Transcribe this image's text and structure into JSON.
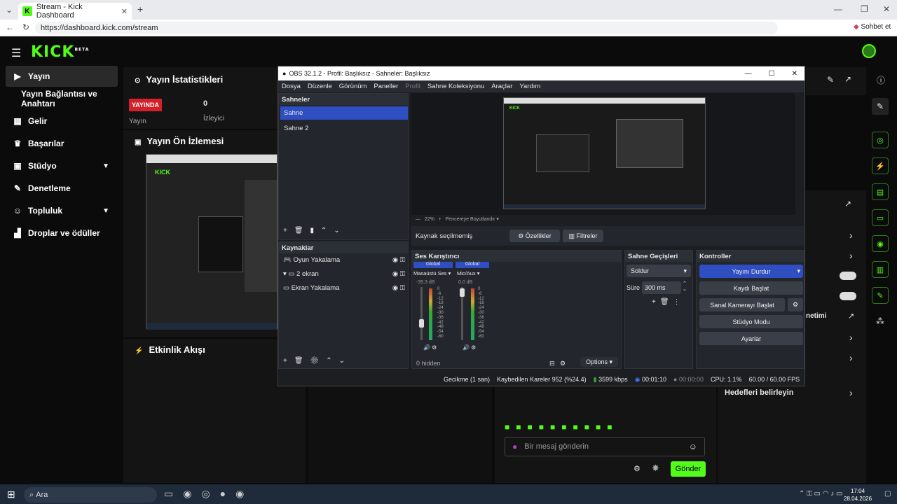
{
  "browser": {
    "tab_title": "Stream - Kick Dashboard",
    "url": "https://dashboard.kick.com/stream",
    "sohbet": "Sohbet et"
  },
  "kick": {
    "logo": "KICK",
    "beta": "BETA",
    "sidebar": [
      {
        "label": "Yayın",
        "icon": "broadcast-icon"
      },
      {
        "label": "Yayın Bağlantısı ve Anahtarı",
        "icon": ""
      },
      {
        "label": "Gelir",
        "icon": "chart-icon"
      },
      {
        "label": "Başarılar",
        "icon": "trophy-icon"
      },
      {
        "label": "Stüdyo",
        "icon": "studio-icon"
      },
      {
        "label": "Denetleme",
        "icon": "wrench-icon"
      },
      {
        "label": "Topluluk",
        "icon": "people-icon"
      },
      {
        "label": "Droplar ve ödüller",
        "icon": "gift-icon"
      }
    ],
    "stats_title": "Yayın İstatistikleri",
    "live_badge": "YAYINDA",
    "yayin_label": "Yayın",
    "viewers_value": "0",
    "viewers_label": "İzleyici",
    "preview_title": "Yayın Ön İzlemesi",
    "activity_title": "Etkinlik Akışı",
    "right_items": [
      "netimi",
      "Hedefleri belirleyin"
    ],
    "chat_placeholder": "Bir mesaj gönderin",
    "send": "Gönder"
  },
  "obs": {
    "title": "OBS 32.1.2 - Profil: Başlıksız - Sahneler: Başlıksız",
    "menu": [
      "Dosya",
      "Düzenle",
      "Görünüm",
      "Paneller",
      "Profil",
      "Sahne Koleksiyonu",
      "Araçlar",
      "Yardım"
    ],
    "scenes_title": "Sahneler",
    "scenes": [
      "Sahne",
      "Sahne 2"
    ],
    "sources_title": "Kaynaklar",
    "sources": [
      "Oyun Yakalama",
      "2 ekran",
      "Ekran Yakalama"
    ],
    "zoom": "22%",
    "resize": "Pencereye Boyutlandır",
    "no_source": "Kaynak seçilmemiş",
    "props": "Özellikler",
    "filters": "Filtreler",
    "mixer_title": "Ses Karıştırıcı",
    "ch1_global": "Global",
    "ch1_name": "Masaüstü Ses",
    "ch1_db": "-35.3 dB",
    "ch2_global": "Global",
    "ch2_name": "Mic/Aux",
    "ch2_db": "0.0 dB",
    "scale": [
      "0",
      "-6",
      "-12",
      "-18",
      "-24",
      "-30",
      "-36",
      "-42",
      "-48",
      "-54",
      "-60"
    ],
    "hidden": "0 hidden",
    "options": "Options",
    "trans_title": "Sahne Geçişleri",
    "trans_value": "Soldur",
    "dur_label": "Süre",
    "dur_value": "300 ms",
    "controls_title": "Kontroller",
    "stop_stream": "Yayını Durdur",
    "start_rec": "Kaydı Başlat",
    "virtual_cam": "Sanal Kamerayı Başlat",
    "studio_mode": "Stüdyo Modu",
    "settings": "Ayarlar",
    "status": {
      "delay": "Gecikme (1 san)",
      "dropped": "Kaybedilen Kareler 952 (%24.4)",
      "kbps": "3599 kbps",
      "stream_time": "00:01:10",
      "rec_time": "00:00:00",
      "cpu": "CPU: 1.1%",
      "fps": "60.00 / 60.00 FPS"
    }
  },
  "taskbar": {
    "search": "Ara",
    "time": "17:04",
    "date": "28.04.2026"
  }
}
